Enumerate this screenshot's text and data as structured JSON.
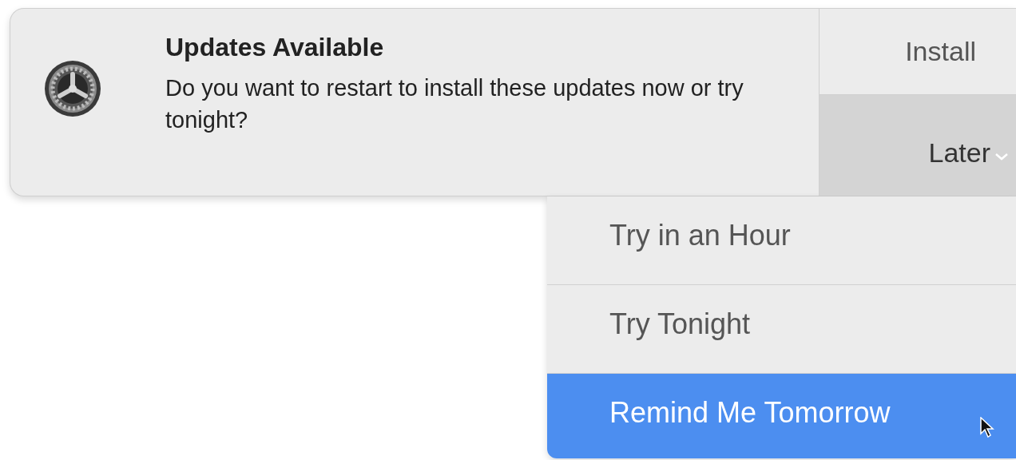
{
  "notification": {
    "title": "Updates Available",
    "message": "Do you want to restart to install these updates now or try tonight?",
    "actions": [
      {
        "label": "Install",
        "kind": "button",
        "expanded": false
      },
      {
        "label": "Later",
        "kind": "menu",
        "expanded": true
      }
    ]
  },
  "menu": {
    "items": [
      {
        "label": "Try in an Hour",
        "selected": false
      },
      {
        "label": "Try Tonight",
        "selected": false
      },
      {
        "label": "Remind Me Tomorrow",
        "selected": true
      }
    ]
  }
}
